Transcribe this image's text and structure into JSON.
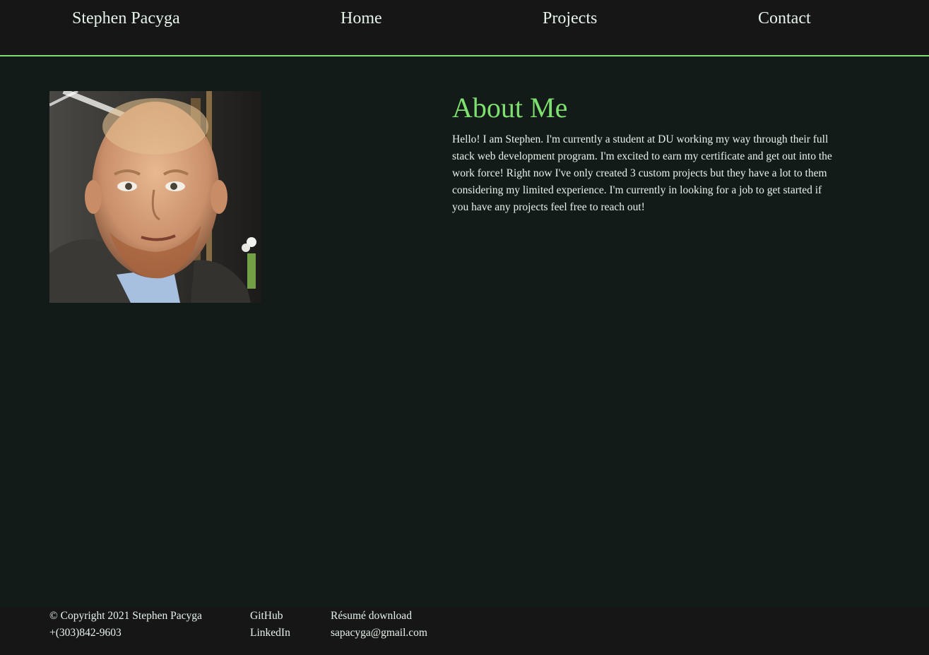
{
  "nav": {
    "brand": "Stephen Pacyga",
    "home": "Home",
    "projects": "Projects",
    "contact": "Contact"
  },
  "about": {
    "heading": "About Me",
    "body": "Hello! I am Stephen. I'm currently a student at DU working my way through their full stack web development program. I'm excited to earn my certificate and get out into the work force! Right now I've only created 3 custom projects but they have a lot to them considering my limited experience. I'm currently in looking for a job to get started if you have any projects feel free to reach out!"
  },
  "footer": {
    "copyright": "© Copyright 2021 Stephen Pacyga",
    "phone": "+(303)842-9603",
    "github": "GitHub",
    "linkedin": "LinkedIn",
    "resume": "Résumé download",
    "email": "sapacyga@gmail.com"
  },
  "colors": {
    "accent": "#7ee06e",
    "nav_background": "#161616",
    "page_background": "#121b18",
    "text": "#e6f3ea"
  }
}
